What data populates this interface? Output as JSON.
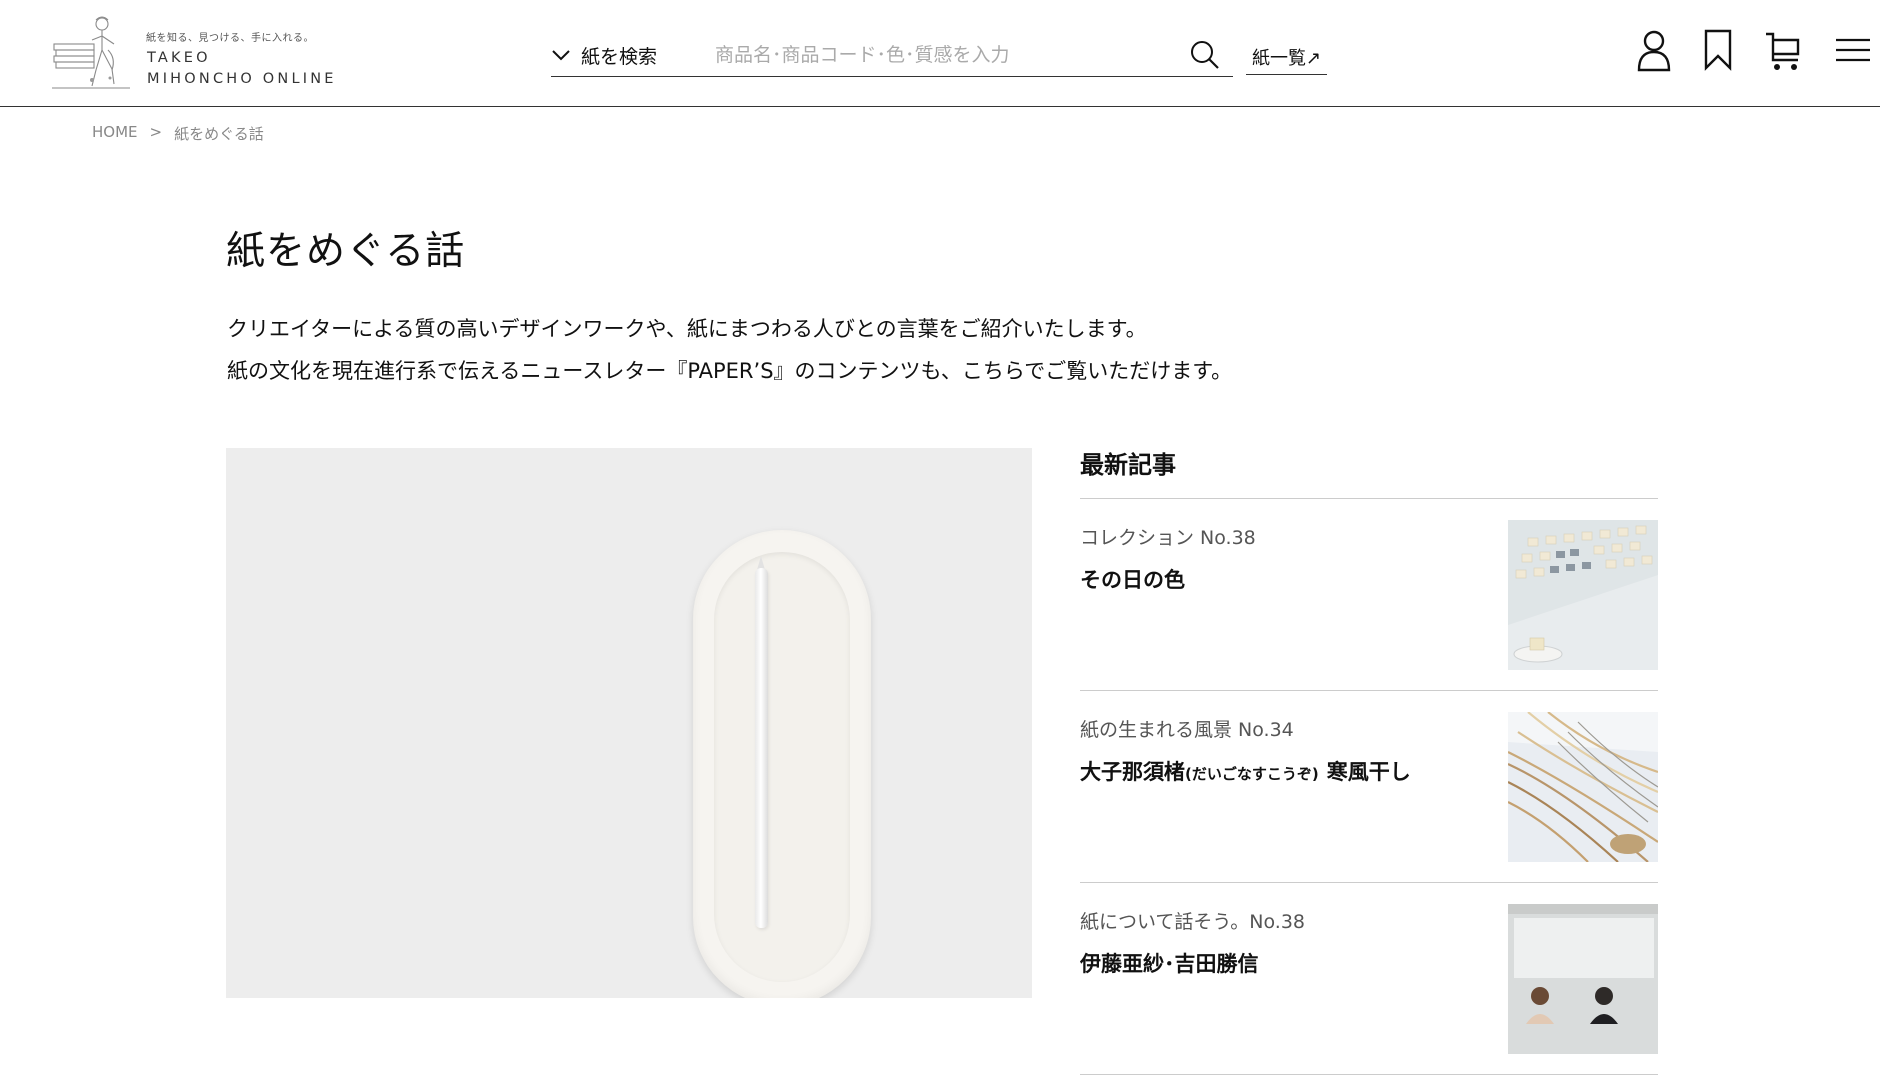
{
  "header": {
    "logo": {
      "tagline": "紙を知る、見つける、手に入れる。",
      "name_line1": "TAKEO",
      "name_line2": "MIHONCHO ONLINE"
    },
    "search": {
      "dropdown_label": "紙を検索",
      "placeholder": "商品名･商品コード･色･質感を入力",
      "value": ""
    },
    "paper_list_label": "紙一覧↗",
    "icons": [
      "user-icon",
      "bookmark-icon",
      "cart-icon",
      "menu-icon"
    ]
  },
  "breadcrumb": {
    "home": "HOME",
    "separator": ">",
    "current": "紙をめぐる話"
  },
  "main": {
    "title": "紙をめぐる話",
    "intro_line1": "クリエイターによる質の高いデザインワークや、紙にまつわる人びとの言葉をご紹介いたします。",
    "intro_line2": "紙の文化を現在進行系で伝えるニュースレター『PAPER’S』のコンテンツも、こちらでご覧いただけます。"
  },
  "latest": {
    "heading": "最新記事",
    "articles": [
      {
        "category": "コレクション No.38",
        "title": "その日の色"
      },
      {
        "category": "紙の生まれる風景 No.34",
        "title": "大子那須楮",
        "title_ruby": "(だいごなすこうぞ)",
        "title_suffix": "寒風干し"
      },
      {
        "category": "紙について話そう。No.38",
        "title": "伊藤亜紗･吉田勝信"
      }
    ]
  }
}
